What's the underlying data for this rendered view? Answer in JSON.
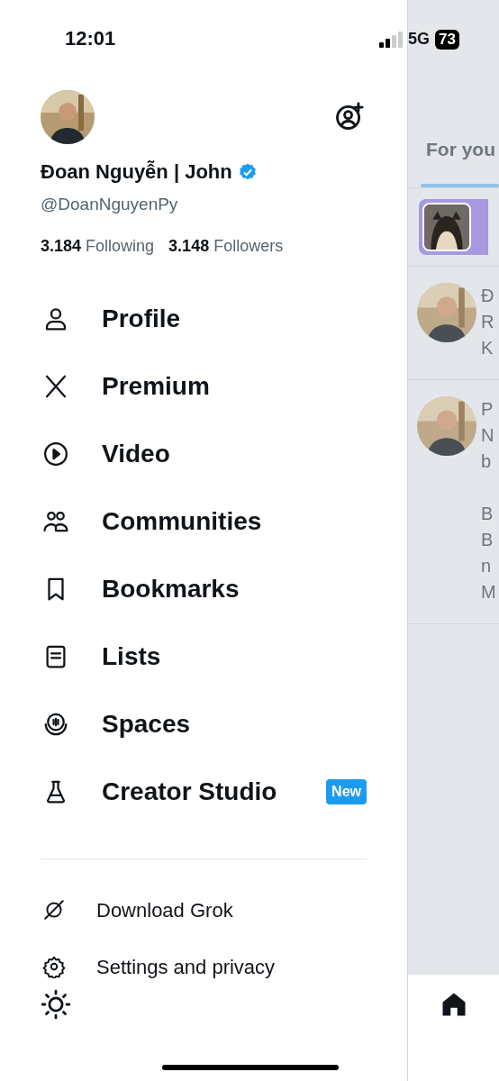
{
  "status_bar": {
    "time": "12:01",
    "network": "5G",
    "battery": "73"
  },
  "drawer": {
    "name": "Đoan Nguyễn | John",
    "verified": true,
    "handle": "@DoanNguyenPy",
    "stats": [
      {
        "count": "3.184",
        "label": "Following"
      },
      {
        "count": "3.148",
        "label": "Followers"
      }
    ],
    "menu": [
      {
        "kind": "person",
        "label": "Profile"
      },
      {
        "kind": "x",
        "label": "Premium"
      },
      {
        "kind": "video",
        "label": "Video"
      },
      {
        "kind": "communities",
        "label": "Communities"
      },
      {
        "kind": "bookmark",
        "label": "Bookmarks"
      },
      {
        "kind": "list",
        "label": "Lists"
      },
      {
        "kind": "spaces",
        "label": "Spaces"
      },
      {
        "kind": "flask",
        "label": "Creator Studio",
        "badge": "New"
      }
    ],
    "secondary": [
      {
        "kind": "grok",
        "label": "Download Grok"
      },
      {
        "kind": "gear",
        "label": "Settings and privacy"
      }
    ]
  },
  "feed": {
    "tab": "For you",
    "posts": [
      {
        "paragraphs": [
          [
            "Đ",
            "R",
            "K"
          ]
        ]
      },
      {
        "paragraphs": [
          [
            "P",
            "N",
            "b"
          ],
          [
            "B",
            "B",
            "n",
            "M"
          ]
        ]
      }
    ]
  }
}
